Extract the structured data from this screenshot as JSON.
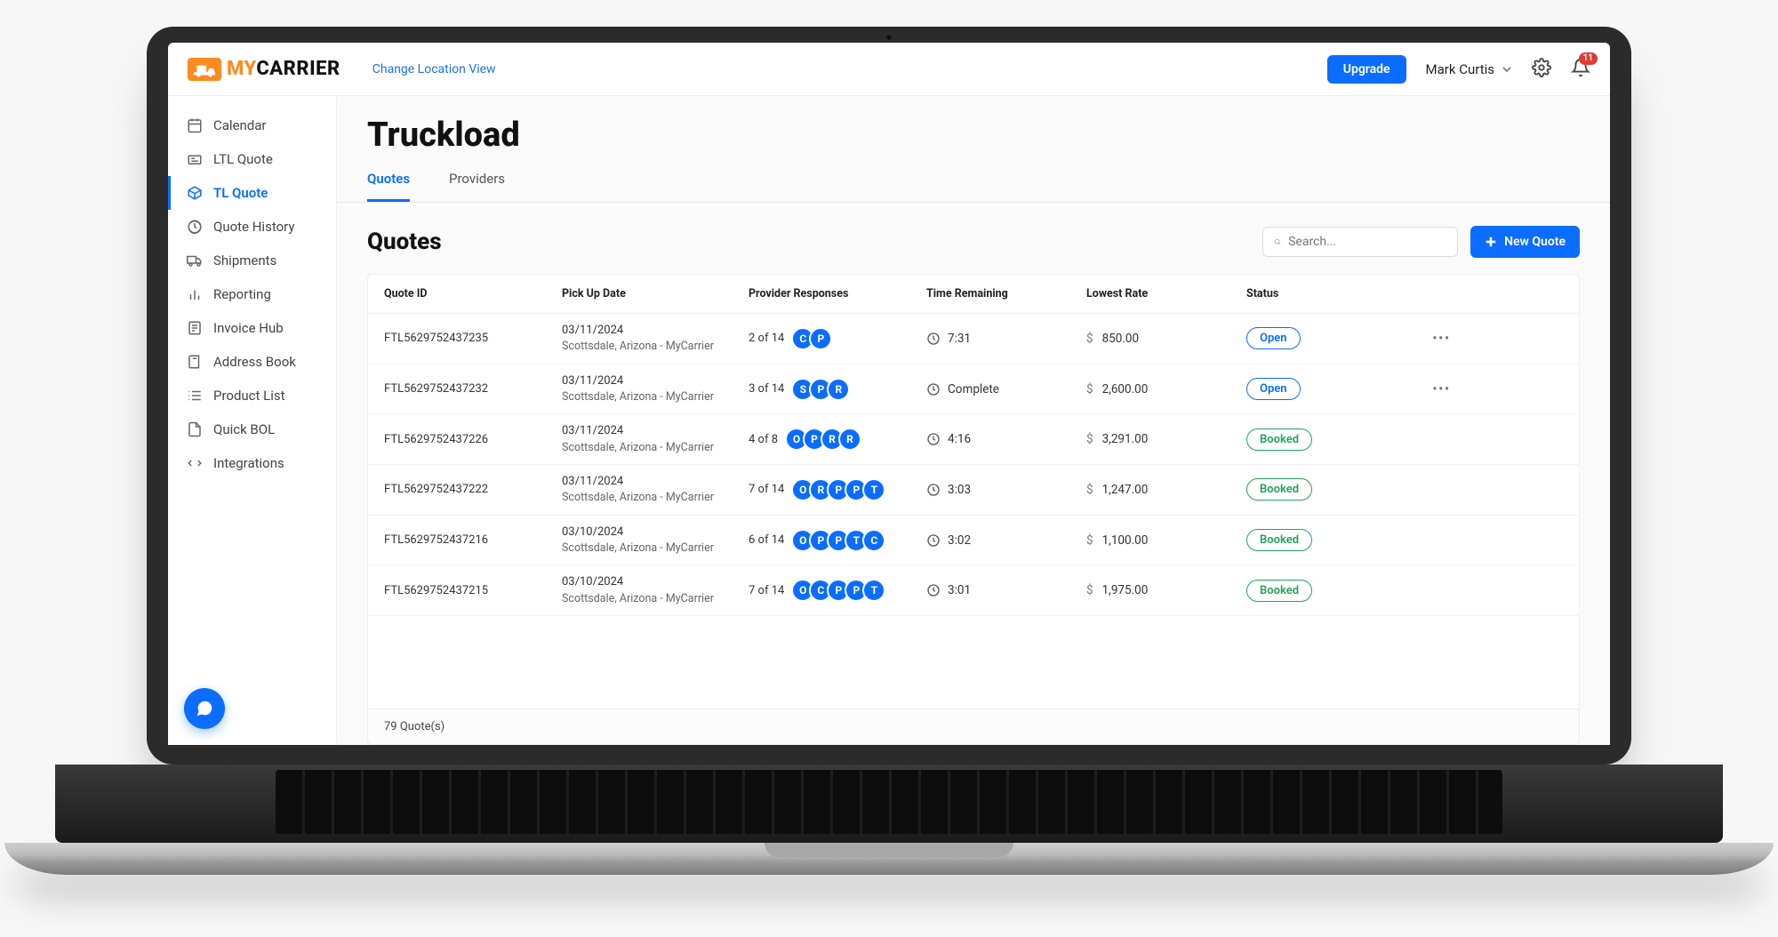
{
  "brand": {
    "my": "MY",
    "carrier": "CARRIER"
  },
  "topbar": {
    "location_link": "Change Location View",
    "upgrade_label": "Upgrade",
    "user_name": "Mark Curtis",
    "notification_count": "11"
  },
  "sidebar": {
    "items": [
      {
        "label": "Calendar",
        "icon": "calendar-icon",
        "active": false
      },
      {
        "label": "LTL Quote",
        "icon": "ltl-quote-icon",
        "active": false
      },
      {
        "label": "TL Quote",
        "icon": "tl-quote-icon",
        "active": true
      },
      {
        "label": "Quote History",
        "icon": "history-icon",
        "active": false
      },
      {
        "label": "Shipments",
        "icon": "truck-icon",
        "active": false
      },
      {
        "label": "Reporting",
        "icon": "report-icon",
        "active": false
      },
      {
        "label": "Invoice Hub",
        "icon": "invoice-icon",
        "active": false
      },
      {
        "label": "Address Book",
        "icon": "book-icon",
        "active": false
      },
      {
        "label": "Product List",
        "icon": "list-icon",
        "active": false
      },
      {
        "label": "Quick BOL",
        "icon": "document-icon",
        "active": false
      },
      {
        "label": "Integrations",
        "icon": "integrations-icon",
        "active": false
      }
    ]
  },
  "page": {
    "title": "Truckload"
  },
  "tabs": [
    {
      "label": "Quotes",
      "active": true
    },
    {
      "label": "Providers",
      "active": false
    }
  ],
  "quotes_section": {
    "title": "Quotes",
    "search_placeholder": "Search...",
    "new_quote_label": "New Quote",
    "columns": [
      "Quote ID",
      "Pick Up Date",
      "Provider Responses",
      "Time Remaining",
      "Lowest Rate",
      "Status"
    ],
    "footer": "79 Quote(s)",
    "rows": [
      {
        "id": "FTL5629752437235",
        "date": "03/11/2024",
        "location": "Scottsdale, Arizona - MyCarrier",
        "resp_count": "2 of 14",
        "chips": [
          "C",
          "P"
        ],
        "time": "7:31",
        "rate": "850.00",
        "status": "Open",
        "has_actions": true
      },
      {
        "id": "FTL5629752437232",
        "date": "03/11/2024",
        "location": "Scottsdale, Arizona - MyCarrier",
        "resp_count": "3 of 14",
        "chips": [
          "S",
          "P",
          "R"
        ],
        "time": "Complete",
        "rate": "2,600.00",
        "status": "Open",
        "has_actions": true
      },
      {
        "id": "FTL5629752437226",
        "date": "03/11/2024",
        "location": "Scottsdale, Arizona - MyCarrier",
        "resp_count": "4 of 8",
        "chips": [
          "O",
          "P",
          "R",
          "R"
        ],
        "time": "4:16",
        "rate": "3,291.00",
        "status": "Booked",
        "has_actions": false
      },
      {
        "id": "FTL5629752437222",
        "date": "03/11/2024",
        "location": "Scottsdale, Arizona - MyCarrier",
        "resp_count": "7 of 14",
        "chips": [
          "O",
          "R",
          "P",
          "P",
          "T"
        ],
        "time": "3:03",
        "rate": "1,247.00",
        "status": "Booked",
        "has_actions": false
      },
      {
        "id": "FTL5629752437216",
        "date": "03/10/2024",
        "location": "Scottsdale, Arizona - MyCarrier",
        "resp_count": "6 of 14",
        "chips": [
          "O",
          "P",
          "P",
          "T",
          "C"
        ],
        "time": "3:02",
        "rate": "1,100.00",
        "status": "Booked",
        "has_actions": false
      },
      {
        "id": "FTL5629752437215",
        "date": "03/10/2024",
        "location": "Scottsdale, Arizona - MyCarrier",
        "resp_count": "7 of 14",
        "chips": [
          "O",
          "C",
          "P",
          "P",
          "T"
        ],
        "time": "3:01",
        "rate": "1,975.00",
        "status": "Booked",
        "has_actions": false
      }
    ]
  }
}
